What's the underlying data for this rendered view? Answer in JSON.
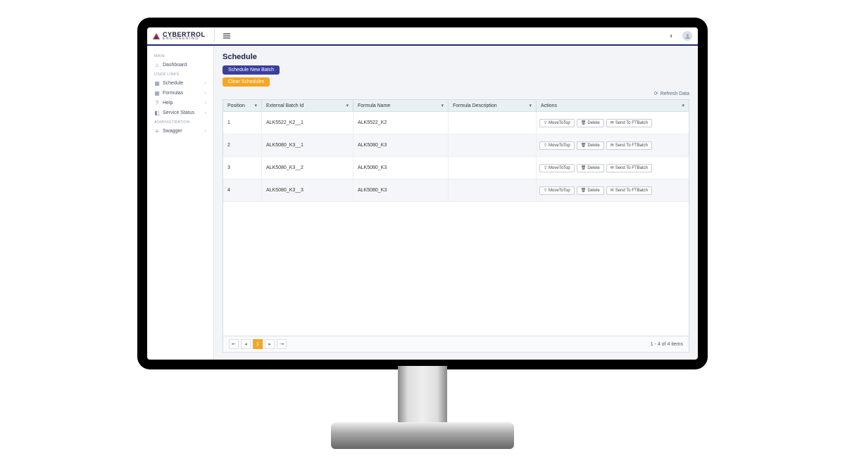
{
  "brand": {
    "name": "CYBERTROL",
    "sub": "ENGINEERING"
  },
  "sidebar": {
    "sections": [
      {
        "label": "MAIN",
        "items": [
          {
            "icon": "home-icon",
            "label": "Dashboard",
            "expandable": false
          }
        ]
      },
      {
        "label": "USER LINKS",
        "items": [
          {
            "icon": "grid-icon",
            "label": "Schedule",
            "expandable": true
          },
          {
            "icon": "grid-icon",
            "label": "Formulas",
            "expandable": true
          },
          {
            "icon": "help-icon",
            "label": "Help",
            "expandable": true
          },
          {
            "icon": "status-icon",
            "label": "Service Status",
            "expandable": true
          }
        ]
      },
      {
        "label": "ADMINISTRATION",
        "items": [
          {
            "icon": "swagger-icon",
            "label": "Swagger",
            "expandable": true
          }
        ]
      }
    ]
  },
  "page": {
    "title": "Schedule",
    "schedule_btn": "Schedule New Batch",
    "clear_btn": "Clear Schedules",
    "refresh": "Refresh Data"
  },
  "table": {
    "columns": [
      "Position",
      "External Batch Id",
      "Formula Name",
      "Formula Description",
      "Actions"
    ],
    "action_labels": {
      "move": "MoveToTop",
      "delete": "Delete",
      "send": "Send To FTBatch"
    },
    "rows": [
      {
        "position": "1",
        "ext": "ALK5522_K2__1",
        "formula": "ALK5522_K2",
        "desc": ""
      },
      {
        "position": "2",
        "ext": "ALK5080_K3__1",
        "formula": "ALK5080_K3",
        "desc": ""
      },
      {
        "position": "3",
        "ext": "ALK5080_K3__2",
        "formula": "ALK5080_K3",
        "desc": ""
      },
      {
        "position": "4",
        "ext": "ALK5080_K3__3",
        "formula": "ALK5080_K3",
        "desc": ""
      }
    ],
    "pager": {
      "current": "1",
      "summary": "1 - 4 of 4 items"
    }
  }
}
